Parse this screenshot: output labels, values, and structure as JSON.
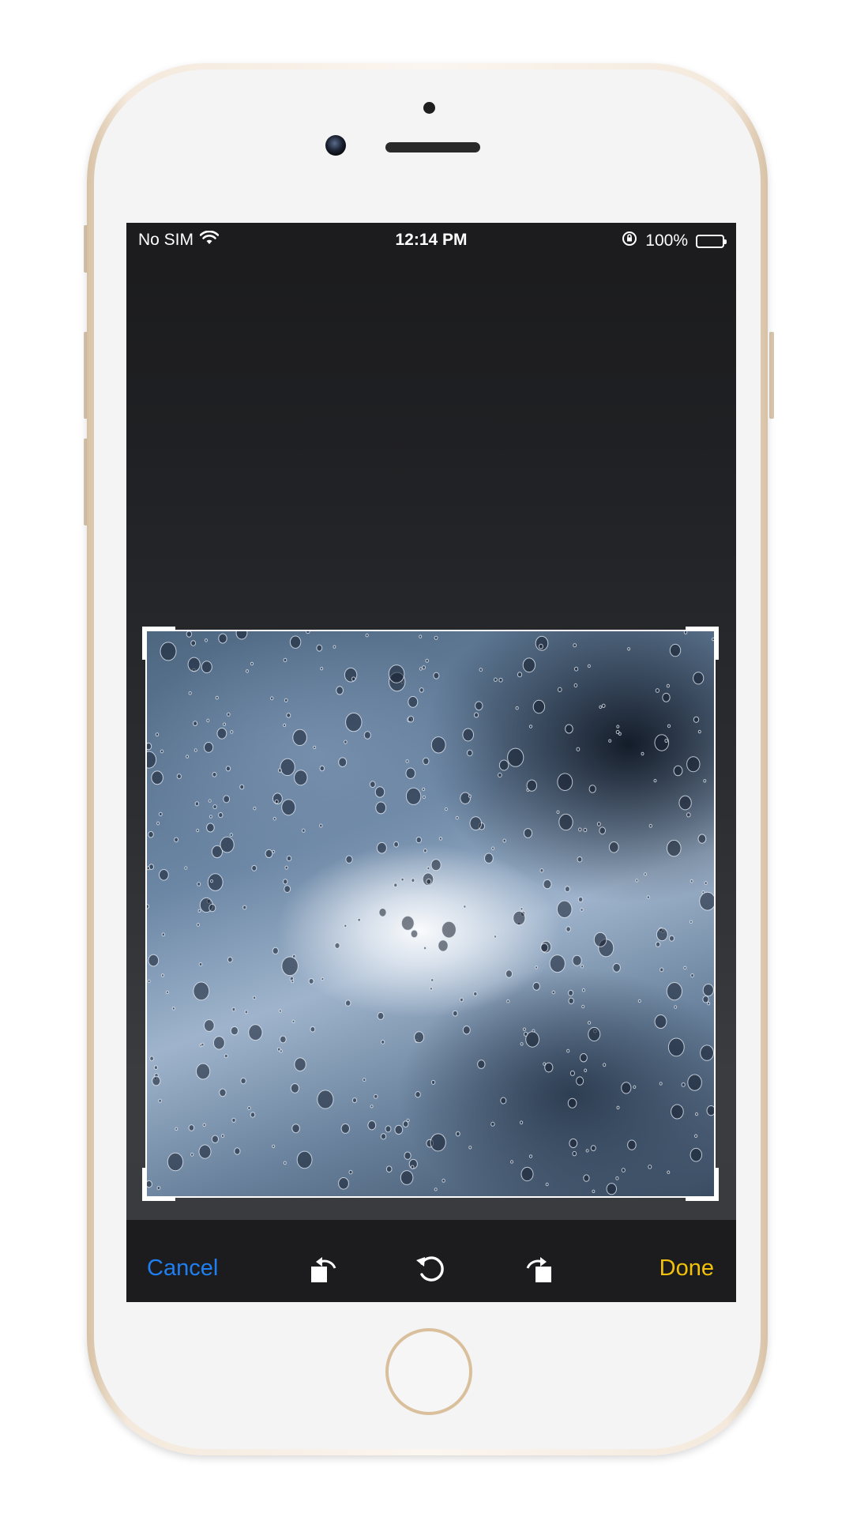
{
  "status_bar": {
    "carrier": "No SIM",
    "time": "12:14 PM",
    "battery": "100%",
    "battery_level": 1.0
  },
  "toolbar": {
    "cancel_label": "Cancel",
    "done_label": "Done",
    "cancel_color": "#1f7ff0",
    "done_color": "#f2c10a",
    "icons": [
      "rotate-left-icon",
      "reset-rotation-icon",
      "rotate-right-icon"
    ]
  },
  "photo": {
    "description_icon": "photo-raindrops"
  }
}
